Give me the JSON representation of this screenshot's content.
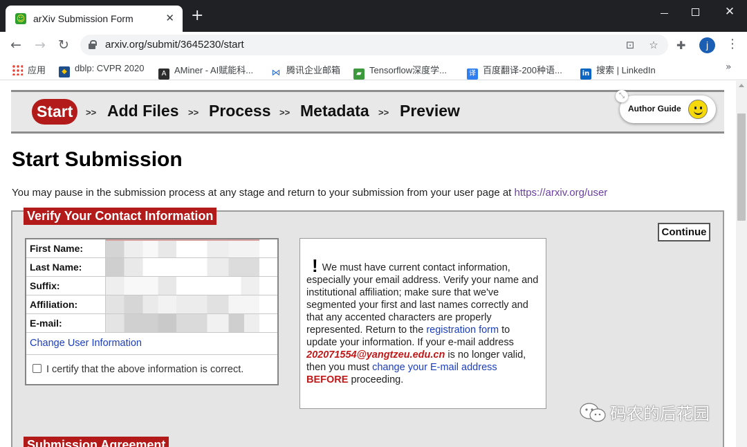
{
  "browser": {
    "tab_title": "arXiv Submission Form",
    "tab_favicon": "smiley-icon",
    "url": "arxiv.org/submit/3645230/start",
    "profile_initial": "j",
    "bookmarks": [
      {
        "label": "应用",
        "icon": "apps-grid-icon"
      },
      {
        "label": "dblp: CVPR 2020",
        "icon": "dblp-icon"
      },
      {
        "label": "AMiner - AI赋能科...",
        "icon": "aminer-icon"
      },
      {
        "label": "腾讯企业邮箱",
        "icon": "tencent-mail-icon"
      },
      {
        "label": "Tensorflow深度学...",
        "icon": "tensorflow-icon"
      },
      {
        "label": "百度翻译-200种语...",
        "icon": "baidu-translate-icon"
      },
      {
        "label": "搜索 | LinkedIn",
        "icon": "linkedin-icon"
      }
    ],
    "bookmarks_more": "»"
  },
  "steps": {
    "active": "Start",
    "items": [
      "Add Files",
      "Process",
      "Metadata",
      "Preview"
    ],
    "separator": ">>"
  },
  "author_guide": {
    "label": "Author Guide"
  },
  "page": {
    "title": "Start Submission",
    "intro_text": "You may pause in the submission process at any stage and return to your submission from your user page at ",
    "intro_link": "https://arxiv.org/user"
  },
  "contact": {
    "section_title": "Verify Your Contact Information",
    "continue_label": "Continue",
    "fields": [
      {
        "label": "First Name:"
      },
      {
        "label": "Last Name:"
      },
      {
        "label": "Suffix:"
      },
      {
        "label": "Affiliation:"
      },
      {
        "label": "E-mail:"
      }
    ],
    "change_link": "Change User Information",
    "certify_label": "I certify that the above information is correct.",
    "certify_checked": false
  },
  "notice": {
    "mark": "!",
    "text_1": "We must have current contact information, especially your email address. Verify your name and institutional affiliation; make sure that we've segmented your first and last names correctly and that any accented characters are properly represented. Return to the ",
    "link_registration": "registration form",
    "text_2": " to update your information. If your e-mail address ",
    "email": "202071554@yangtzeu.edu.cn",
    "text_3": " is no longer valid, then you must ",
    "link_change_email": "change your E-mail address",
    "text_4": " ",
    "before_word": "BEFORE",
    "text_5": " proceeding."
  },
  "next_section": {
    "title": "Submission Agreement"
  },
  "watermark": {
    "text": "码农的后花园"
  },
  "colors": {
    "arxiv_red": "#b31b1b",
    "link_blue": "#1a3dc0",
    "visited_link": "#6a3ea1",
    "chrome_dark": "#202124"
  }
}
